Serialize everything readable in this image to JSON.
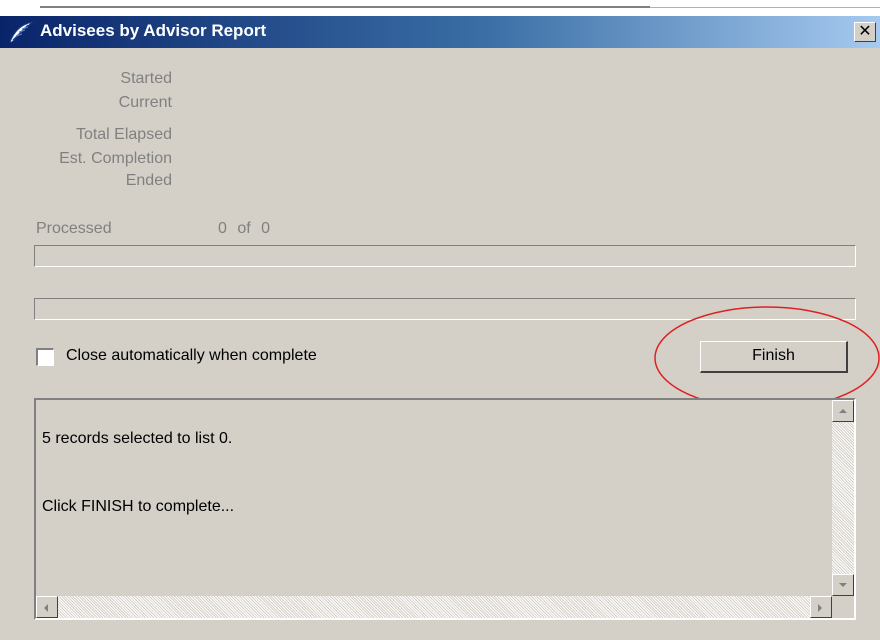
{
  "window": {
    "title": "Advisees by Advisor Report",
    "close_glyph": "✕"
  },
  "timing": {
    "started_label": "Started",
    "current_label": "Current",
    "total_elapsed_label": "Total Elapsed",
    "est_completion_label": "Est. Completion",
    "ended_label": "Ended"
  },
  "progress": {
    "processed_label": "Processed",
    "processed_count": "0  of  0",
    "bar1_fraction": 0,
    "bar2_fraction": 0
  },
  "options": {
    "close_auto_label": "Close automatically when complete",
    "close_auto_checked": false
  },
  "actions": {
    "finish_label": "Finish"
  },
  "log": {
    "lines": [
      "5 records selected to list 0.",
      "Click FINISH to complete..."
    ]
  },
  "colors": {
    "titlebar_start": "#0a246a",
    "titlebar_end": "#a6caf0",
    "annotation": "#e02020",
    "face": "#d4d0c8"
  },
  "icons": {
    "app": "feather-app-icon",
    "close": "close-icon",
    "scroll_up": "arrow-up-icon",
    "scroll_down": "arrow-down-icon",
    "scroll_left": "arrow-left-icon",
    "scroll_right": "arrow-right-icon"
  }
}
